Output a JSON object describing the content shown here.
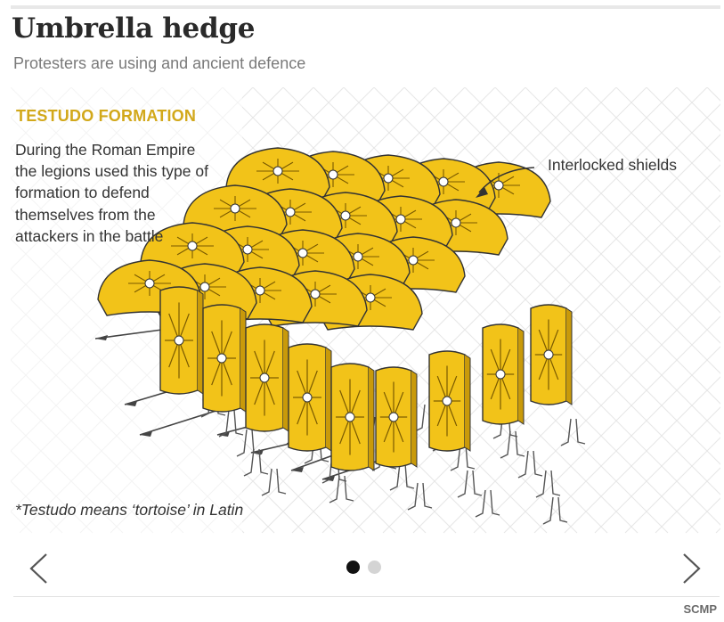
{
  "header": {
    "title": "Umbrella hedge",
    "subtitle": "Protesters are using and ancient defence"
  },
  "slide": {
    "label": "TESTUDO FORMATION",
    "description": "During the Roman Empire the legions used this type of formation to defend themselves from the attackers in the battle",
    "callout": "Interlocked shields",
    "footnote": "*Testudo means ‘tortoise’ in Latin",
    "shield_color": "#f2c319",
    "shield_dark": "#c99a0a",
    "grid_color": "#e6e6e6"
  },
  "carousel": {
    "active_index": 0,
    "pages": 2
  },
  "footer": {
    "credit": "SCMP"
  }
}
